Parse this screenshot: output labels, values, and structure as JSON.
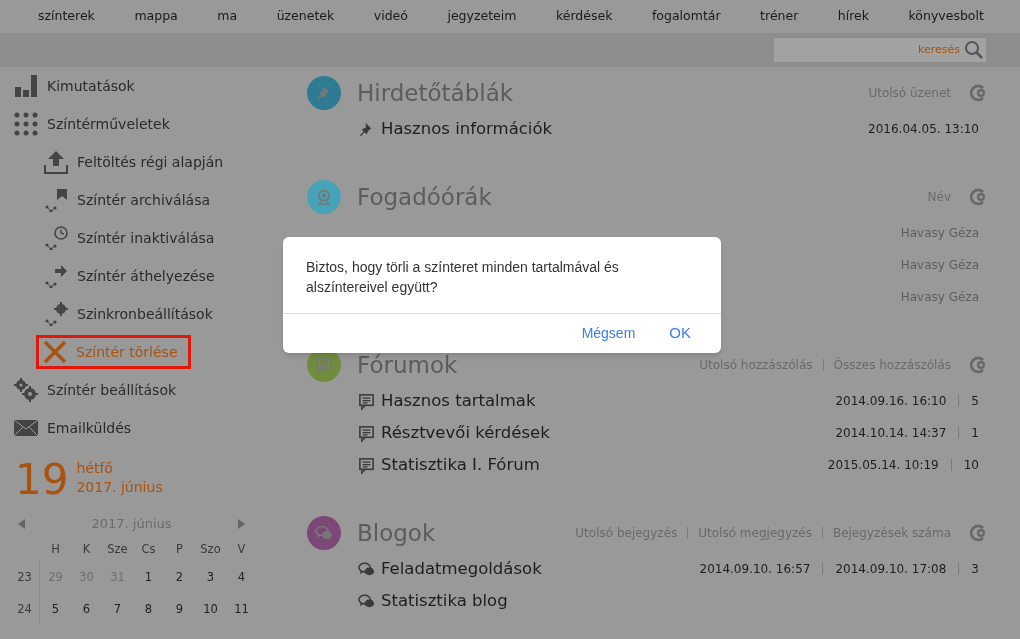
{
  "nav": [
    "színterek",
    "mappa",
    "ma",
    "üzenetek",
    "videó",
    "jegyzeteim",
    "kérdések",
    "fogalomtár",
    "tréner",
    "hírek",
    "könyvesbolt"
  ],
  "search": {
    "placeholder": "keresés"
  },
  "sidebar": {
    "items": [
      {
        "label": "Kimutatások",
        "selected": false
      },
      {
        "label": "Színtérműveletek",
        "selected": false,
        "children": [
          {
            "label": "Feltöltés régi alapján",
            "selected": false
          },
          {
            "label": "Színtér archiválása",
            "selected": false
          },
          {
            "label": "Színtér inaktiválása",
            "selected": false
          },
          {
            "label": "Színtér áthelyezése",
            "selected": false
          },
          {
            "label": "Szinkronbeállítások",
            "selected": false
          },
          {
            "label": "Színtér törlése",
            "selected": true
          }
        ]
      },
      {
        "label": "Színtér beállítások",
        "selected": false
      },
      {
        "label": "Emailküldés",
        "selected": false
      }
    ]
  },
  "date": {
    "day": "19",
    "weekday": "hétfő",
    "month": "2017. június"
  },
  "calendar": {
    "title": "2017. június",
    "weekdays": [
      "H",
      "K",
      "Sze",
      "Cs",
      "P",
      "Szo",
      "V"
    ],
    "weeks": [
      {
        "number": "23",
        "days": [
          {
            "day": "29",
            "outside": true
          },
          {
            "day": "30",
            "outside": true
          },
          {
            "day": "31",
            "outside": true
          },
          {
            "day": "1",
            "outside": false
          },
          {
            "day": "2",
            "outside": false
          },
          {
            "day": "3",
            "outside": false
          },
          {
            "day": "4",
            "outside": false
          }
        ]
      },
      {
        "number": "24",
        "days": [
          {
            "day": "5",
            "outside": false
          },
          {
            "day": "6",
            "outside": false
          },
          {
            "day": "7",
            "outside": false
          },
          {
            "day": "8",
            "outside": false
          },
          {
            "day": "9",
            "outside": false
          },
          {
            "day": "10",
            "outside": false
          },
          {
            "day": "11",
            "outside": false
          }
        ]
      }
    ]
  },
  "sections": [
    {
      "title": "Hirdetőtáblák",
      "kind": "pin",
      "color": "#2f7b94",
      "columns": [
        "Utolsó üzenet"
      ],
      "items": [
        {
          "label": "Hasznos információk",
          "cells": [
            "2016.04.05. 13:10"
          ]
        }
      ]
    },
    {
      "title": "Fogadóórák",
      "kind": "webcam",
      "color": "#47a3b8",
      "columns": [
        "Név"
      ],
      "items": [
        {
          "cells": [
            "Havasy Géza"
          ]
        },
        {
          "cells": [
            "Havasy Géza"
          ]
        },
        {
          "cells": [
            "Havasy Géza"
          ]
        }
      ]
    },
    {
      "title": "Fórumok",
      "kind": "forum",
      "color": "#6f8d3c",
      "columns": [
        "Utolsó hozzászólás",
        "Összes hozzászólás"
      ],
      "items": [
        {
          "label": "Hasznos tartalmak",
          "cells": [
            "2014.09.16. 16:10",
            "5"
          ]
        },
        {
          "label": "Résztvevői kérdések",
          "cells": [
            "2014.10.14. 14:37",
            "1"
          ]
        },
        {
          "label": "Statisztika I. Fórum",
          "cells": [
            "2015.05.14. 10:19",
            "10"
          ]
        }
      ]
    },
    {
      "title": "Blogok",
      "kind": "blog",
      "color": "#7b4877",
      "columns": [
        "Utolsó bejegyzés",
        "Utolsó megjegyzés",
        "Bejegyzések száma"
      ],
      "items": [
        {
          "label": "Feladatmegoldások",
          "cells": [
            "2014.09.10. 16:57",
            "2014.09.10. 17:08",
            "3"
          ]
        },
        {
          "label": "Statisztika blog"
        }
      ]
    }
  ],
  "dialog": {
    "message": "Biztos, hogy törli a színteret minden tartalmával és alszíntereivel együtt?",
    "buttons": [
      {
        "label": "Mégsem",
        "kind": "cancel"
      },
      {
        "label": "OK",
        "kind": "confirm"
      }
    ]
  }
}
